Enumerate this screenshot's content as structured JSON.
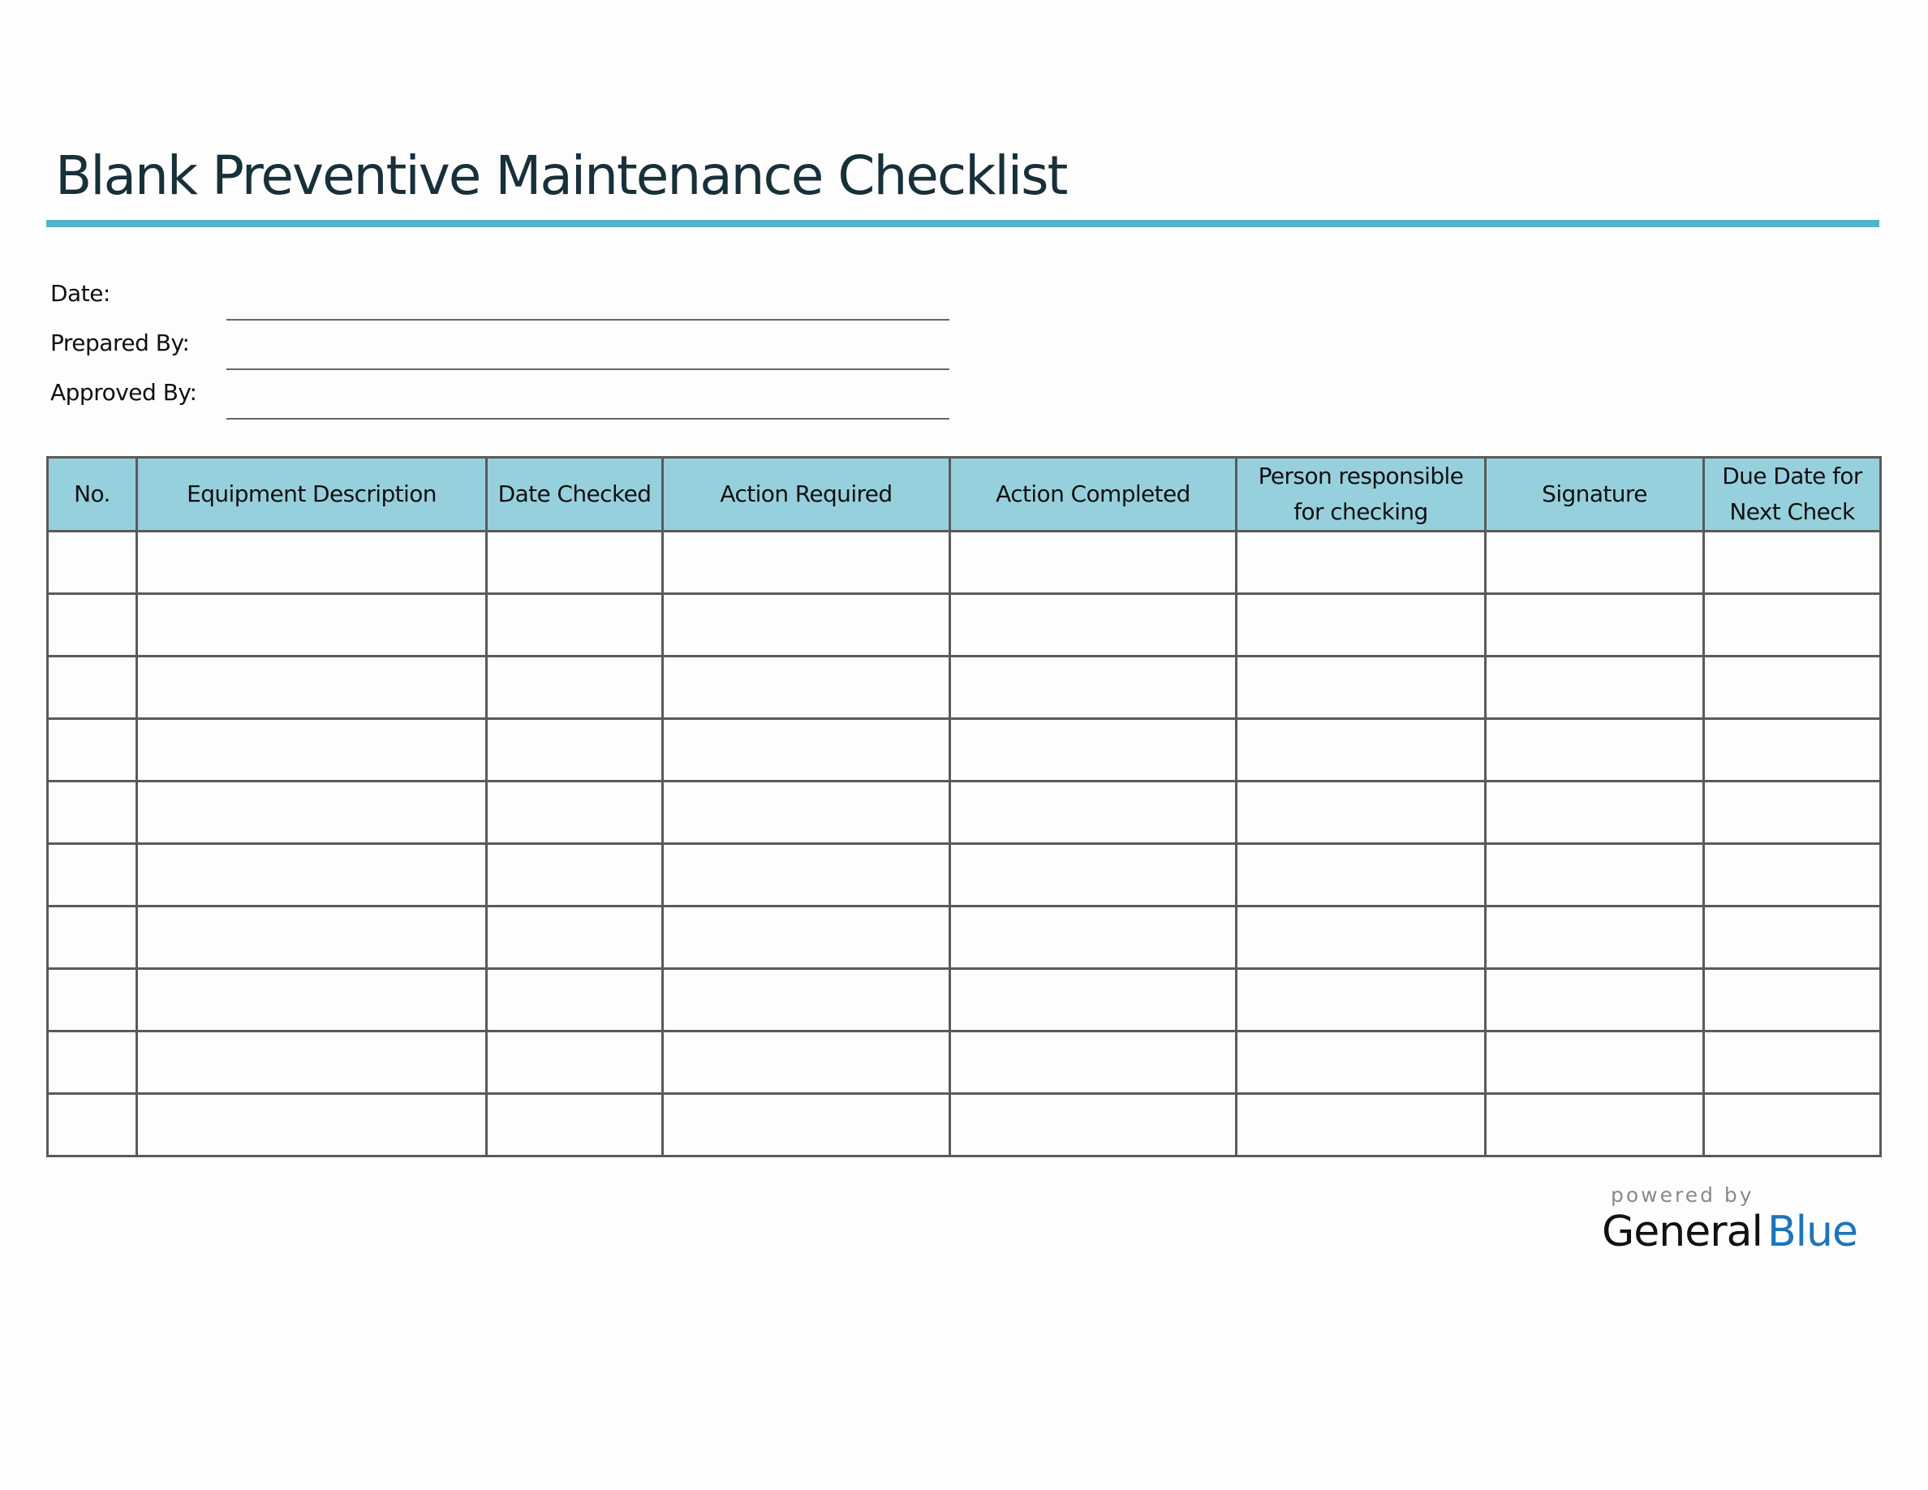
{
  "document": {
    "title": "Blank Preventive Maintenance Checklist"
  },
  "fields": [
    {
      "label": "Date:",
      "value": ""
    },
    {
      "label": "Prepared By:",
      "value": ""
    },
    {
      "label": "Approved By:",
      "value": ""
    }
  ],
  "table": {
    "headers": [
      "No.",
      "Equipment Description",
      "Date Checked",
      "Action Required",
      "Action Completed",
      "Person responsible for checking",
      "Signature",
      "Due Date for Next Check"
    ],
    "row_count": 10,
    "rows": [
      [
        "",
        "",
        "",
        "",
        "",
        "",
        "",
        ""
      ],
      [
        "",
        "",
        "",
        "",
        "",
        "",
        "",
        ""
      ],
      [
        "",
        "",
        "",
        "",
        "",
        "",
        "",
        ""
      ],
      [
        "",
        "",
        "",
        "",
        "",
        "",
        "",
        ""
      ],
      [
        "",
        "",
        "",
        "",
        "",
        "",
        "",
        ""
      ],
      [
        "",
        "",
        "",
        "",
        "",
        "",
        "",
        ""
      ],
      [
        "",
        "",
        "",
        "",
        "",
        "",
        "",
        ""
      ],
      [
        "",
        "",
        "",
        "",
        "",
        "",
        "",
        ""
      ],
      [
        "",
        "",
        "",
        "",
        "",
        "",
        "",
        ""
      ],
      [
        "",
        "",
        "",
        "",
        "",
        "",
        "",
        ""
      ]
    ]
  },
  "footer": {
    "powered_by": "powered by",
    "brand_part1": "General",
    "brand_part2": "Blue"
  },
  "colors": {
    "accent_rule": "#53b3c9",
    "header_fill": "#97d0dd",
    "title_color": "#17303a",
    "brand_blue": "#1b75bb"
  }
}
